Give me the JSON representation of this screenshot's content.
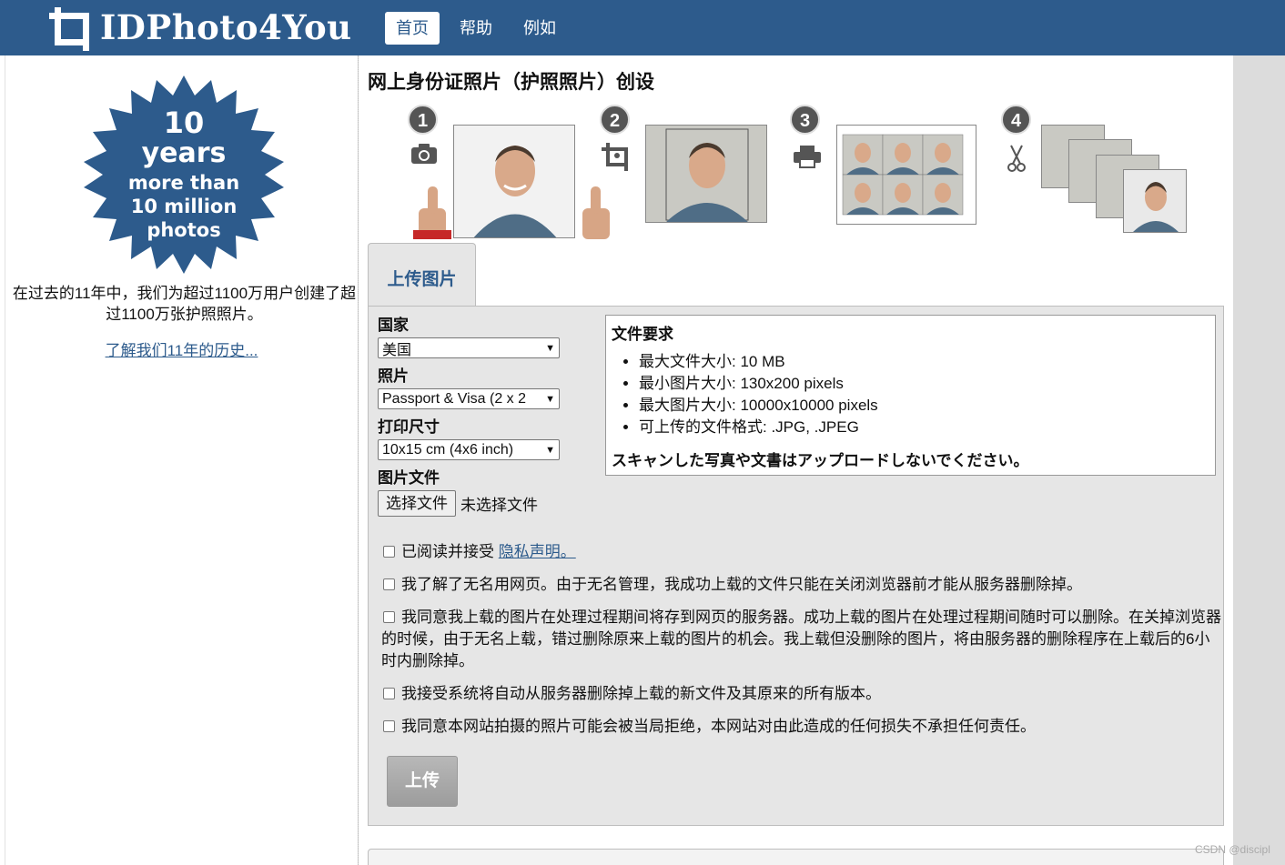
{
  "header": {
    "logo_text": "IDPhoto4You",
    "nav": [
      {
        "label": "首页",
        "active": true
      },
      {
        "label": "帮助",
        "active": false
      },
      {
        "label": "例如",
        "active": false
      }
    ]
  },
  "sidebar": {
    "badge": {
      "line1": "10",
      "line2": "years",
      "line3": "more than",
      "line4": "10 million",
      "line5": "photos"
    },
    "description": "在过去的11年中，我们为超过1100万用户创建了超过1100万张护照照片。",
    "history_link": "了解我们11年的历史..."
  },
  "main": {
    "title": "网上身份证照片（护照照片）创设",
    "steps": [
      {
        "number": "1",
        "icon": "camera-icon"
      },
      {
        "number": "2",
        "icon": "crop-icon"
      },
      {
        "number": "3",
        "icon": "printer-icon"
      },
      {
        "number": "4",
        "icon": "scissors-icon"
      }
    ],
    "tab_label": "上传图片",
    "form": {
      "country_label": "国家",
      "country_value": "美国",
      "photo_label": "照片",
      "photo_value": "Passport & Visa (2 x 2",
      "print_label": "打印尺寸",
      "print_value": "10x15 cm (4x6 inch)",
      "file_label": "图片文件",
      "file_button": "选择文件",
      "file_status": "未选择文件"
    },
    "requirements": {
      "title": "文件要求",
      "items": [
        "最大文件大小: 10 MB",
        "最小图片大小: 130x200 pixels",
        "最大图片大小: 10000x10000 pixels",
        "可上传的文件格式: .JPG, .JPEG"
      ],
      "warning": "スキャンした写真や文書はアップロードしないでください。"
    },
    "checkboxes": {
      "privacy_prefix": "已阅读并接受",
      "privacy_link": "隐私声明。",
      "anonymous": "我了解了无名用网页。由于无名管理，我成功上载的文件只能在关闭浏览器前才能从服务器删除掉。",
      "storage": "我同意我上载的图片在处理过程期间将存到网页的服务器。成功上载的图片在处理过程期间随时可以删除。在关掉浏览器的时候，由于无名上载，错过删除原来上载的图片的机会。我上载但没删除的图片，将由服务器的删除程序在上载后的6小时内删除掉。",
      "auto_delete": "我接受系统将自动从服务器删除掉上载的新文件及其原来的所有版本。",
      "rejection": "我同意本网站拍摄的照片可能会被当局拒绝，本网站对由此造成的任何损失不承担任何责任。"
    },
    "upload_button": "上传"
  },
  "watermark": "CSDN @discipl",
  "colors": {
    "brand": "#2d5b8c",
    "panel": "#e6e6e6",
    "button_disabled": "#a8a8a8"
  }
}
